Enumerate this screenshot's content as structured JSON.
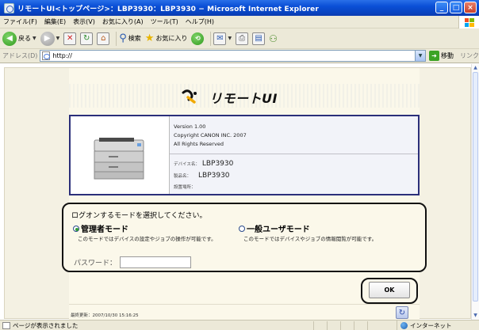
{
  "window": {
    "title": "リモートUI<トップページ>：LBP3930：LBP3930 − Microsoft Internet Explorer",
    "buttons": [
      "minimize",
      "maximize",
      "close"
    ]
  },
  "menu": {
    "items": [
      "ファイル(F)",
      "編集(E)",
      "表示(V)",
      "お気に入り(A)",
      "ツール(T)",
      "ヘルプ(H)"
    ]
  },
  "toolbar": {
    "back_label": "戻る",
    "search_label": "検索",
    "favorites_label": "お気に入り"
  },
  "address": {
    "label": "アドレス(D)",
    "value": "http://",
    "go_label": "移動",
    "links_label": "リンク"
  },
  "page": {
    "logo_text": "リモートUI",
    "info": {
      "version": "Version 1.00",
      "copyright": "Copyright CANON INC. 2007",
      "rights": "All Rights Reserved",
      "device_name_label": "デバイス名：",
      "device_name": "LBP3930",
      "product_name_label": "製品名：",
      "product_name": "LBP3930",
      "location_label": "設置場所："
    },
    "login": {
      "prompt": "ログオンするモードを選択してください。",
      "admin_mode": "管理者モード",
      "admin_desc": "このモードではデバイスの設定やジョブの操作が可能です。",
      "general_mode": "一般ユーザモード",
      "general_desc": "このモードではデバイスやジョブの情報閲覧が可能です。",
      "selected_mode": "admin",
      "password_label": "パスワード：",
      "password_value": ""
    },
    "ok_label": "OK",
    "last_updated": "最終更新：2007/10/30 15:16:25"
  },
  "status": {
    "text": "ページが表示されました",
    "zone": "インターネット"
  },
  "colors": {
    "titlebar": "#0a4fd6",
    "info_border": "#2b2f7a",
    "page_background": "#fbf8ea",
    "radio_selected": "#2f9c35"
  }
}
